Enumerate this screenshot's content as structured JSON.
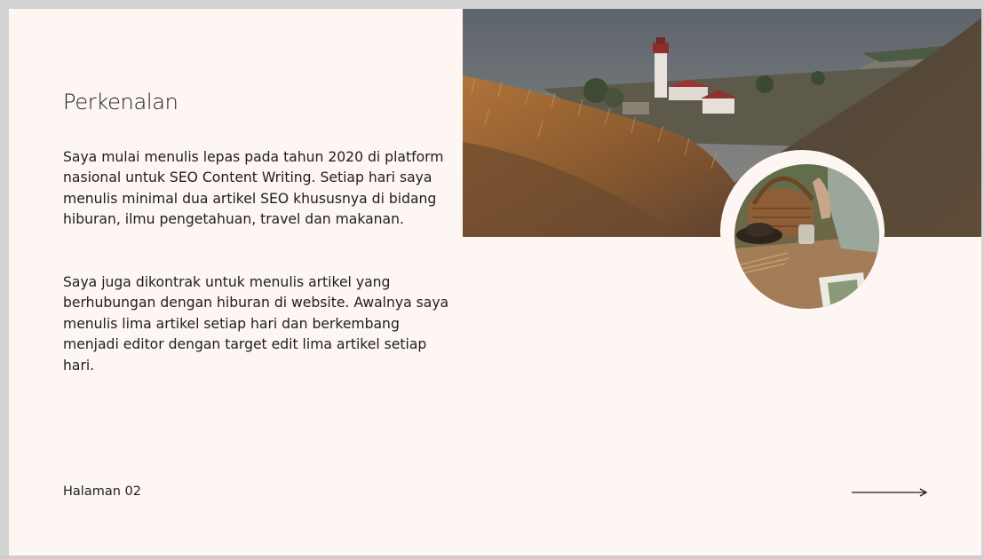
{
  "slide": {
    "title": "Perkenalan",
    "paragraphs": [
      "Saya mulai menulis lepas pada tahun 2020 di platform nasional untuk SEO Content Writing. Setiap hari saya menulis minimal dua artikel SEO khususnya di bidang hiburan, ilmu pengetahuan, travel dan makanan.",
      "Saya juga dikontrak untuk menulis artikel yang berhubungan dengan hiburan di website. Awalnya saya menulis lima artikel setiap hari dan berkembang menjadi editor dengan target edit lima artikel setiap hari."
    ],
    "page_label": "Halaman 02"
  },
  "colors": {
    "slide_background": "#fdf6f2",
    "text": "#1e1e1e",
    "outer_background": "#d4d3d4"
  },
  "icons": {
    "next": "arrow-right-icon"
  }
}
